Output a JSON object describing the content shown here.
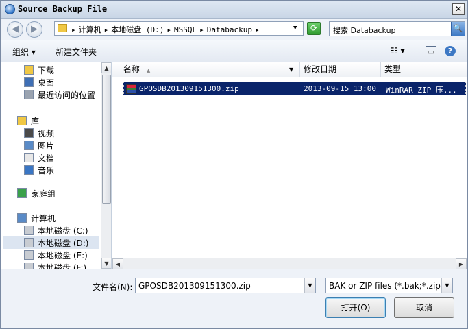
{
  "window": {
    "title": "Source Backup File",
    "close_glyph": "✕"
  },
  "nav": {
    "back_glyph": "◀",
    "forward_glyph": "▶"
  },
  "address": {
    "crumbs": [
      "▸",
      "计算机",
      "▸",
      "本地磁盘 (D:)",
      "▸",
      "MSSQL",
      "▸",
      "Databackup",
      "▸"
    ],
    "dropdown_glyph": "▼",
    "refresh_glyph": "⟳"
  },
  "search": {
    "text": "搜索 Databackup",
    "icon_glyph": "🔍"
  },
  "toolbar": {
    "organize_label": "组织 ▾",
    "new_folder_label": "新建文件夹",
    "view_glyph": "☷ ▾",
    "preview_glyph": "▭",
    "help_glyph": "?"
  },
  "sidebar": {
    "items": [
      {
        "label": "下载",
        "indent": 1,
        "color": "#f0c845"
      },
      {
        "label": "桌面",
        "indent": 1,
        "color": "#3f6fb5"
      },
      {
        "label": "最近访问的位置",
        "indent": 1,
        "color": "#9aa3b0"
      },
      {
        "label": "库",
        "indent": 0,
        "color": "#f0c845"
      },
      {
        "label": "视频",
        "indent": 1,
        "color": "#4a4a4a"
      },
      {
        "label": "图片",
        "indent": 1,
        "color": "#5a8bc7"
      },
      {
        "label": "文档",
        "indent": 1,
        "color": "#e8e8e8"
      },
      {
        "label": "音乐",
        "indent": 1,
        "color": "#3a76c4"
      },
      {
        "label": "家庭组",
        "indent": 0,
        "color": "#3aa14a"
      },
      {
        "label": "计算机",
        "indent": 0,
        "color": "#5a8bc7"
      },
      {
        "label": "本地磁盘 (C:)",
        "indent": 1,
        "color": "#c8ccd2"
      },
      {
        "label": "本地磁盘 (D:)",
        "indent": 1,
        "color": "#c8ccd2",
        "selected": true
      },
      {
        "label": "本地磁盘 (E:)",
        "indent": 1,
        "color": "#c8ccd2"
      },
      {
        "label": "本地磁盘 (F:)",
        "indent": 1,
        "color": "#c8ccd2"
      }
    ],
    "scroll_up_glyph": "▲",
    "scroll_down_glyph": "▼"
  },
  "list": {
    "columns": {
      "name": "名称",
      "sort_glyph": "▲",
      "name_dd_glyph": "▼",
      "date": "修改日期",
      "type": "类型"
    },
    "rows": [
      {
        "name": "GPOSDB201309151300.zip",
        "date": "2013-09-15 13:00",
        "type": "WinRAR ZIP 压..."
      }
    ],
    "hscroll_left_glyph": "◀",
    "hscroll_right_glyph": "▶"
  },
  "bottom": {
    "filename_label": "文件名(N):",
    "filename_value": "GPOSDB201309151300.zip",
    "filetype_value": "BAK or ZIP files (*.bak;*.zip)",
    "dropdown_glyph": "▼",
    "open_label": "打开(O)",
    "cancel_label": "取消"
  }
}
